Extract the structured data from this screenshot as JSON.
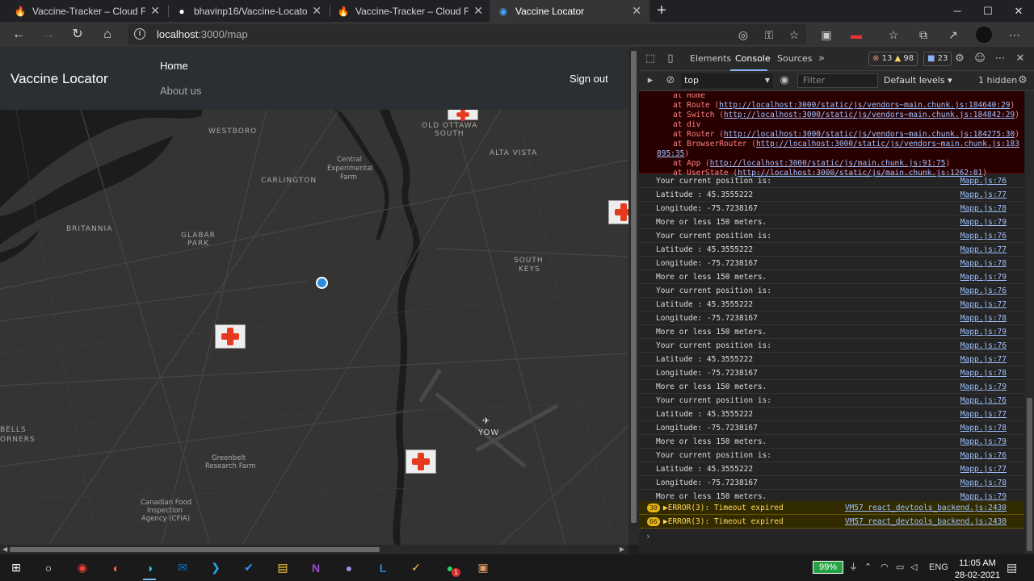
{
  "browser": {
    "tabs": [
      {
        "title": "Vaccine-Tracker – Cloud Firestore",
        "active": false
      },
      {
        "title": "bhavinp16/Vaccine-Locator: CSI",
        "active": false
      },
      {
        "title": "Vaccine-Tracker – Cloud Firestore",
        "active": false
      },
      {
        "title": "Vaccine Locator",
        "active": true
      }
    ],
    "url_host": "localhost",
    "url_path": ":3000/map"
  },
  "app": {
    "brand": "Vaccine Locator",
    "nav_home": "Home",
    "nav_about": "About us",
    "nav_signout": "Sign out"
  },
  "map": {
    "labels": {
      "westboro": "WESTBORO",
      "old_ottawa": "OLD OTTAWA",
      "south": "SOUTH",
      "alta_vista": "ALTA VISTA",
      "central": "Central",
      "experimental": "Experimental",
      "farm": "Farm",
      "carlington": "CARLINGTON",
      "britannia": "BRITANNIA",
      "glabar": "GLABAR",
      "park": "PARK",
      "south2": "SOUTH",
      "keys": "KEYS",
      "yow": "YOW",
      "bells": "BELLS",
      "corners": "ORNERS",
      "greenbelt": "Greenbelt",
      "research_farm": "Research Farm",
      "cfia1": "Canadian Food",
      "cfia2": "Inspection",
      "cfia3": "Agency (CFIA)"
    }
  },
  "devtools": {
    "tabs": [
      "Elements",
      "Console",
      "Sources"
    ],
    "active_tab": "Console",
    "errors_count": "13",
    "warnings_count": "98",
    "messages_count": "23",
    "context": "top",
    "filter_placeholder": "Filter",
    "levels": "Default levels",
    "hidden": "1 hidden",
    "stack": {
      "l0": "at Home",
      "l1_pre": "at Route (",
      "l1_link": "http://localhost:3000/static/js/vendors~main.chunk.js:184640:29",
      "l2_pre": "at Switch (",
      "l2_link": "http://localhost:3000/static/js/vendors~main.chunk.js:184842:29",
      "l3": "at div",
      "l4_pre": "at Router (",
      "l4_link": "http://localhost:3000/static/js/vendors~main.chunk.js:184275:30",
      "l5_pre": "at BrowserRouter (",
      "l5_link": "http://localhost:3000/static/js/vendors~main.chunk.js:183",
      "l5b_link": "895:35",
      "l6_pre": "at App (",
      "l6_link": "http://localhost:3000/static/js/main.chunk.js:91:75",
      "l7_pre": "at UserState (",
      "l7_link": "http://localhost:3000/static/js/main.chunk.js:1262:81"
    },
    "logs": [
      {
        "msg": "Your current position is:",
        "src": "Mapp.js:76"
      },
      {
        "msg": "Latitude : 45.3555222",
        "src": "Mapp.js:77"
      },
      {
        "msg": "Longitude: -75.7238167",
        "src": "Mapp.js:78"
      },
      {
        "msg": "More or less 150 meters.",
        "src": "Mapp.js:79"
      },
      {
        "msg": "Your current position is:",
        "src": "Mapp.js:76"
      },
      {
        "msg": "Latitude : 45.3555222",
        "src": "Mapp.js:77"
      },
      {
        "msg": "Longitude: -75.7238167",
        "src": "Mapp.js:78"
      },
      {
        "msg": "More or less 150 meters.",
        "src": "Mapp.js:79"
      },
      {
        "msg": "Your current position is:",
        "src": "Mapp.js:76"
      },
      {
        "msg": "Latitude : 45.3555222",
        "src": "Mapp.js:77"
      },
      {
        "msg": "Longitude: -75.7238167",
        "src": "Mapp.js:78"
      },
      {
        "msg": "More or less 150 meters.",
        "src": "Mapp.js:79"
      },
      {
        "msg": "Your current position is:",
        "src": "Mapp.js:76"
      },
      {
        "msg": "Latitude : 45.3555222",
        "src": "Mapp.js:77"
      },
      {
        "msg": "Longitude: -75.7238167",
        "src": "Mapp.js:78"
      },
      {
        "msg": "More or less 150 meters.",
        "src": "Mapp.js:79"
      },
      {
        "msg": "Your current position is:",
        "src": "Mapp.js:76"
      },
      {
        "msg": "Latitude : 45.3555222",
        "src": "Mapp.js:77"
      },
      {
        "msg": "Longitude: -75.7238167",
        "src": "Mapp.js:78"
      },
      {
        "msg": "More or less 150 meters.",
        "src": "Mapp.js:79"
      },
      {
        "msg": "Your current position is:",
        "src": "Mapp.js:76"
      },
      {
        "msg": "Latitude : 45.3555222",
        "src": "Mapp.js:77"
      },
      {
        "msg": "Longitude: -75.7238167",
        "src": "Mapp.js:78"
      },
      {
        "msg": "More or less 150 meters.",
        "src": "Mapp.js:79"
      }
    ],
    "warns": [
      {
        "count": "30",
        "msg": "ERROR(3): Timeout expired",
        "src": "VM57 react_devtools_backend.js:2430"
      },
      {
        "count": "66",
        "msg": "ERROR(3): Timeout expired",
        "src": "VM57 react_devtools_backend.js:2430"
      }
    ]
  },
  "taskbar": {
    "battery": "99%",
    "lang": "ENG",
    "time": "11:05 AM",
    "date": "28-02-2021",
    "whatsapp_badge": "1"
  }
}
